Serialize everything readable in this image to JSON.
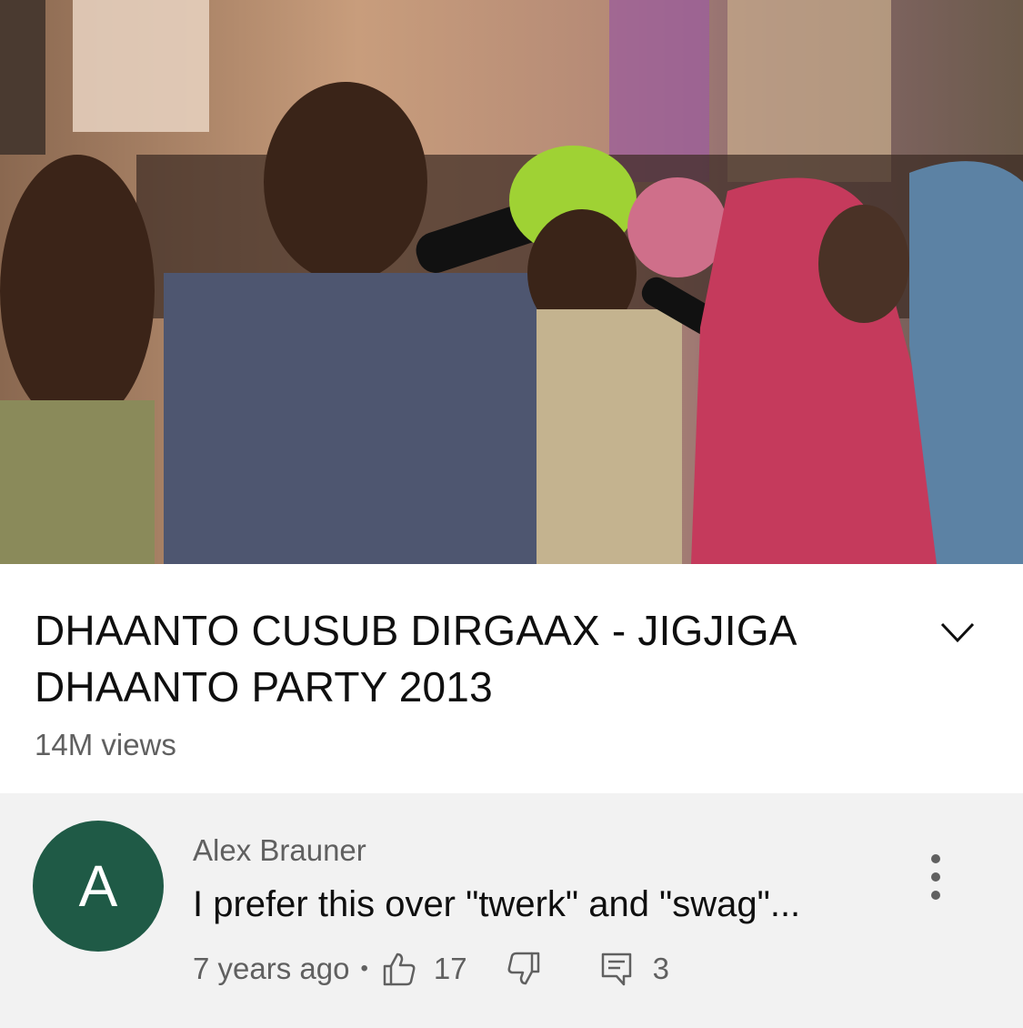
{
  "video": {
    "title": "DHAANTO CUSUB DIRGAAX - JIGJIGA DHAANTO PARTY 2013",
    "views": "14M views",
    "expand_icon": "chevron-down-icon"
  },
  "comment": {
    "avatar_letter": "A",
    "avatar_color": "#1f5a46",
    "author": "Alex Brauner",
    "text": "I prefer this over \"twerk\" and \"swag\"...",
    "time": "7 years ago",
    "separator": "•",
    "like_count": "17",
    "reply_count": "3",
    "icons": [
      "thumbs-up-icon",
      "thumbs-down-icon",
      "reply-icon",
      "more-vertical-icon"
    ]
  }
}
